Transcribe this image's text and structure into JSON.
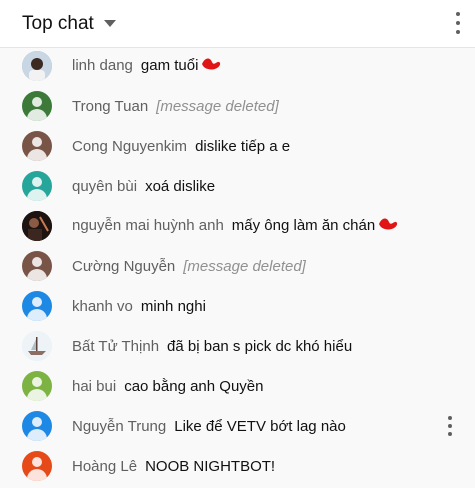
{
  "header": {
    "title": "Top chat"
  },
  "messages": [
    {
      "author": "linh dang",
      "text": "gam tuổi",
      "avatar": "photo",
      "color": "#9ab0c8",
      "scribble": true
    },
    {
      "author": "Trong Tuan",
      "text": "[message deleted]",
      "avatar": "default",
      "color": "#3d7a3a",
      "deleted": true
    },
    {
      "author": "Cong Nguyenkim",
      "text": "dislike tiếp a e",
      "avatar": "default",
      "color": "#795548"
    },
    {
      "author": "quyên bùi",
      "text": "xoá dislike",
      "avatar": "default",
      "color": "#26a69a"
    },
    {
      "author": "nguyễn mai huỳnh anh",
      "text": "mấy ông làm ăn chán",
      "avatar": "photo-dark",
      "color": "#2b1d1a",
      "scribble": true
    },
    {
      "author": "Cường Nguyễn",
      "text": "[message deleted]",
      "avatar": "default",
      "color": "#795548",
      "deleted": true
    },
    {
      "author": "khanh vo",
      "text": "minh nghi",
      "avatar": "default",
      "color": "#1e88e5"
    },
    {
      "author": "Bất Tử Thịnh",
      "text": "đã bị ban s pick dc khó hiểu",
      "avatar": "photo-boat",
      "color": "#e6eef5"
    },
    {
      "author": "hai bui",
      "text": "cao bằng anh Quyền",
      "avatar": "default",
      "color": "#7cb342"
    },
    {
      "author": "Nguyễn Trung",
      "text": "Like để VETV bớt lag nào",
      "avatar": "default",
      "color": "#1e88e5",
      "menu": true
    },
    {
      "author": "Hoàng Lê",
      "text": "NOOB NIGHTBOT!",
      "avatar": "default",
      "color": "#e64a19"
    }
  ]
}
